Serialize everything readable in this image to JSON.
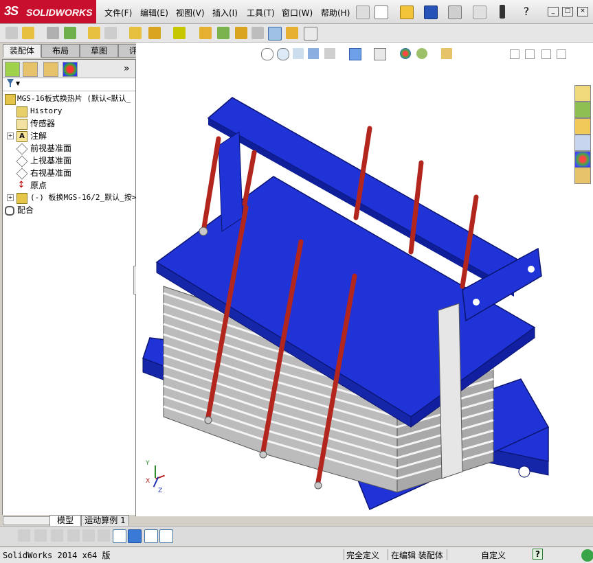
{
  "app": {
    "logo_ds": "3S",
    "logo_text": "SOLIDWORKS",
    "menus": [
      "文件(F)",
      "编辑(E)",
      "视图(V)",
      "插入(I)",
      "工具(T)",
      "窗口(W)",
      "帮助(H)"
    ]
  },
  "command_tabs": [
    "装配体",
    "布局",
    "草图",
    "评估"
  ],
  "tree": {
    "root": "MGS-16板式换热片  (默认<默认_",
    "items": [
      {
        "label": "History",
        "expandable": false
      },
      {
        "label": "传感器",
        "expandable": false
      },
      {
        "label": "注解",
        "expandable": true
      },
      {
        "label": "前视基准面",
        "expandable": false
      },
      {
        "label": "上视基准面",
        "expandable": false
      },
      {
        "label": "右视基准面",
        "expandable": false
      },
      {
        "label": "原点",
        "expandable": false
      },
      {
        "label": "(-) 板换MGS-16/2_默认_按>",
        "expandable": true
      },
      {
        "label": "配合",
        "expandable": false
      }
    ]
  },
  "bottom_tabs": [
    "模型",
    "运动算例 1"
  ],
  "status": {
    "app_version": "SolidWorks 2014 x64 版",
    "definition": "完全定义",
    "editing": "在编辑 装配体",
    "units": "自定义",
    "help": "?"
  },
  "triad": {
    "x": "X",
    "y": "Y",
    "z": "Z"
  },
  "colors": {
    "blue_frame": "#1f33d6",
    "red_rod": "#b3261e",
    "plate_gray": "#d9d9d9",
    "logo_red": "#c8102e"
  }
}
